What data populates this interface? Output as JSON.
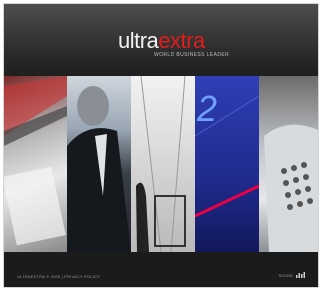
{
  "header": {
    "logo_white": "ultra",
    "logo_red": "extra",
    "tagline": "WORLD BUSINESS LEADER"
  },
  "images": [
    {
      "name": "pen-and-documents-image"
    },
    {
      "name": "businessman-image"
    },
    {
      "name": "office-corridor-image"
    },
    {
      "name": "blue-glass-building-image"
    },
    {
      "name": "telephone-keypad-image"
    }
  ],
  "footer": {
    "copyright": "ULTRAEXTRA © 2005 | PRIVACY POLICY",
    "sound_label": "SOUND"
  },
  "colors": {
    "accent_red": "#e11c1c",
    "background": "#1b1b1b"
  }
}
